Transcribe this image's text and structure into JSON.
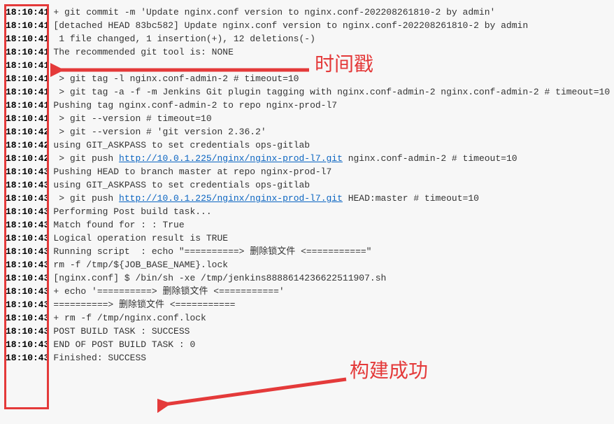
{
  "annotations": {
    "timestamp_label": "时间戳",
    "build_success_label": "构建成功"
  },
  "log_lines": [
    {
      "ts": "18:10:41",
      "type": "plain",
      "text": "+ git commit -m 'Update nginx.conf version to nginx.conf-202208261810-2 by admin'"
    },
    {
      "ts": "18:10:41",
      "type": "plain",
      "text": "[detached HEAD 83bc582] Update nginx.conf version to nginx.conf-202208261810-2 by admin"
    },
    {
      "ts": "18:10:41",
      "type": "plain",
      "text": " 1 file changed, 1 insertion(+), 12 deletions(-)"
    },
    {
      "ts": "18:10:41",
      "type": "plain",
      "text": "The recommended git tool is: NONE"
    },
    {
      "ts": "18:10:41",
      "type": "plain",
      "text": ""
    },
    {
      "ts": "18:10:41",
      "type": "plain",
      "text": " > git tag -l nginx.conf-admin-2 # timeout=10"
    },
    {
      "ts": "18:10:41",
      "type": "plain",
      "text": " > git tag -a -f -m Jenkins Git plugin tagging with nginx.conf-admin-2 nginx.conf-admin-2 # timeout=10"
    },
    {
      "ts": "18:10:41",
      "type": "plain",
      "text": "Pushing tag nginx.conf-admin-2 to repo nginx-prod-l7"
    },
    {
      "ts": "18:10:41",
      "type": "plain",
      "text": " > git --version # timeout=10"
    },
    {
      "ts": "18:10:42",
      "type": "plain",
      "text": " > git --version # 'git version 2.36.2'"
    },
    {
      "ts": "18:10:42",
      "type": "plain",
      "text": "using GIT_ASKPASS to set credentials ops-gitlab"
    },
    {
      "ts": "18:10:42",
      "type": "link",
      "before": " > git push ",
      "url": "http://10.0.1.225/nginx/nginx-prod-l7.git",
      "after": " nginx.conf-admin-2 # timeout=10"
    },
    {
      "ts": "18:10:43",
      "type": "plain",
      "text": "Pushing HEAD to branch master at repo nginx-prod-l7"
    },
    {
      "ts": "18:10:43",
      "type": "plain",
      "text": "using GIT_ASKPASS to set credentials ops-gitlab"
    },
    {
      "ts": "18:10:43",
      "type": "link",
      "before": " > git push ",
      "url": "http://10.0.1.225/nginx/nginx-prod-l7.git",
      "after": " HEAD:master # timeout=10"
    },
    {
      "ts": "18:10:43",
      "type": "plain",
      "text": "Performing Post build task..."
    },
    {
      "ts": "18:10:43",
      "type": "plain",
      "text": "Match found for : : True"
    },
    {
      "ts": "18:10:43",
      "type": "plain",
      "text": "Logical operation result is TRUE"
    },
    {
      "ts": "18:10:43",
      "type": "plain",
      "text": "Running script  : echo \"==========> 删除锁文件 <===========\""
    },
    {
      "ts": "18:10:43",
      "type": "plain",
      "text": "rm -f /tmp/${JOB_BASE_NAME}.lock"
    },
    {
      "ts": "18:10:43",
      "type": "plain",
      "text": "[nginx.conf] $ /bin/sh -xe /tmp/jenkins8888614236622511907.sh"
    },
    {
      "ts": "18:10:43",
      "type": "plain",
      "text": "+ echo '==========> 删除锁文件 <==========='"
    },
    {
      "ts": "18:10:43",
      "type": "plain",
      "text": "==========> 删除锁文件 <==========="
    },
    {
      "ts": "18:10:43",
      "type": "plain",
      "text": "+ rm -f /tmp/nginx.conf.lock"
    },
    {
      "ts": "18:10:43",
      "type": "plain",
      "text": "POST BUILD TASK : SUCCESS"
    },
    {
      "ts": "18:10:43",
      "type": "plain",
      "text": "END OF POST BUILD TASK : 0"
    },
    {
      "ts": "18:10:43",
      "type": "plain",
      "text": "Finished: SUCCESS"
    }
  ]
}
